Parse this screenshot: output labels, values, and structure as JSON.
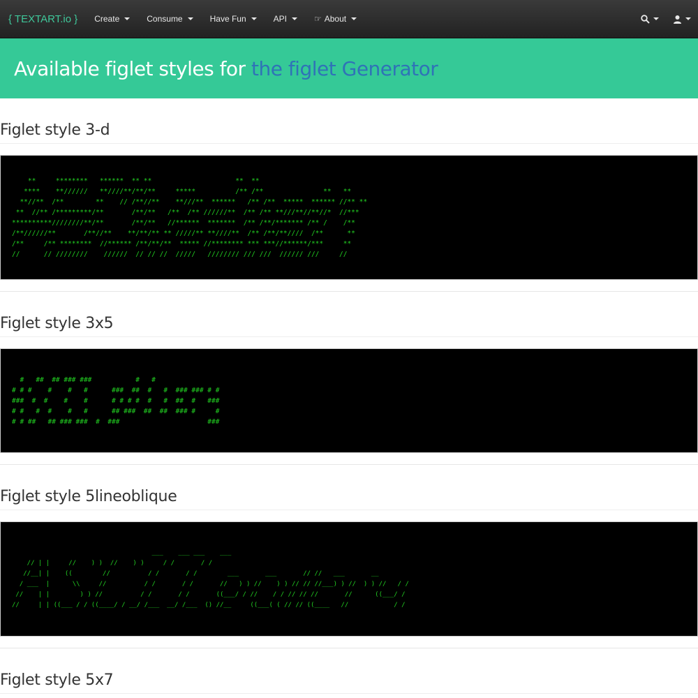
{
  "nav": {
    "brand": "{ TEXTART.io }",
    "items": [
      {
        "label": "Create",
        "icon": ""
      },
      {
        "label": "Consume",
        "icon": ""
      },
      {
        "label": "Have Fun",
        "icon": ""
      },
      {
        "label": "API",
        "icon": ""
      },
      {
        "label": "About",
        "icon": "hand-pointing-icon"
      }
    ],
    "right_icons": [
      "search-icon",
      "user-icon"
    ]
  },
  "hero": {
    "title_prefix": "Available figlet styles for ",
    "title_link": "the figlet Generator"
  },
  "sections": [
    {
      "title": "Figlet style 3-d",
      "art": "    **     ********   ******  ** **                     **  **\n   ****    **//////   **////**/**/**     *****          /** /**               **   **\n  **//**  /**        **    // /**//**    **///**  ******   /** /**  *****  ****** //** **\n **  //** /*********/**       /**/**   /**  /** //////**  /** /** **///**//**//*  //***\n**********////////**/**       /**/**   //******  *******  /** /**/******* /** /    /**\n/**//////**       /**//**    **/**/** ** /////** **////**  /** /**/**////  /**      **\n/**     /** ********  //****** /**/**/**  ***** //******** *** ***//******/***     **\n//      // ////////    //////  // // //  /////   //////// /// ///  ////// ///     //"
    },
    {
      "title": "Figlet style 3x5",
      "art": "  #   ##  ## ### ###           #   #\n# # #    #    #   #      ###  ##  #   #  ### ### # #\n###  #  #    #    #      # # # #  #   #  ##  #   ###\n# #   #  #    #   #      ## ###  ##  ##  ### #     #\n# # ##   ## ### ###  #  ###                      ###"
    },
    {
      "title": "Figlet style 5lineoblique",
      "art": "                                     ___    ___ ___    ___\n    // | |     //    ) )  //    ) )     / /       / /\n   //__| |    ((        //          / /       / /        ___       ___       // //   ___       __\n  / ___  |      \\\\     //          / /       / /       //   ) ) //    ) ) // // //___) ) //  ) ) //   / /\n //    | |        ) ) //          / /       / /       ((___/ / //    / / // // //       //      ((___/ /\n//     | | ((___ / / ((____/ / __/ /___  __/ /___  () //__     ((___( ( // // ((____   //            / /"
    },
    {
      "title": "Figlet style 5x7",
      "art": ""
    }
  ]
}
